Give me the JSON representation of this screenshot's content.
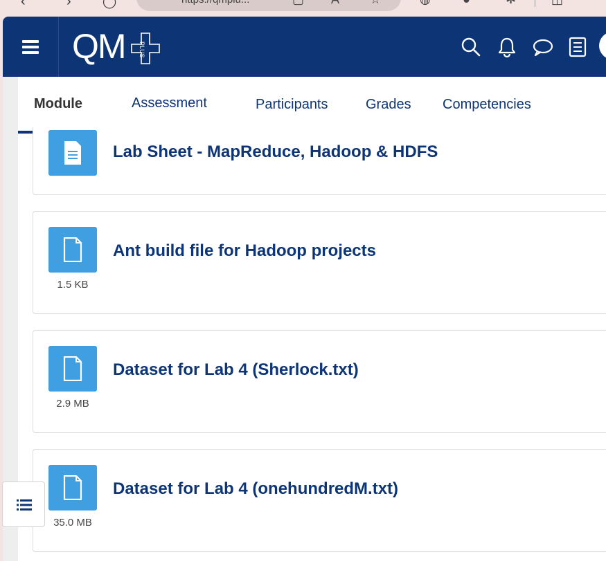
{
  "browser": {
    "url_partial": "https://qmplu..."
  },
  "header": {
    "logo_text": "QM",
    "logo_sub": "PLUS",
    "icons": [
      "search-icon",
      "bell-icon",
      "chat-icon",
      "list-icon"
    ]
  },
  "tabs": [
    {
      "label": "Module",
      "active": true
    },
    {
      "label": "Assessment",
      "active": false
    },
    {
      "label": "Participants",
      "active": false
    },
    {
      "label": "Grades",
      "active": false
    },
    {
      "label": "Competencies",
      "active": false
    }
  ],
  "resources": [
    {
      "title": "Lab Sheet - MapReduce, Hadoop & HDFS",
      "size": "",
      "icon": "document-icon"
    },
    {
      "title": "Ant build file for Hadoop projects",
      "size": "1.5 KB",
      "icon": "file-icon"
    },
    {
      "title": "Dataset for Lab 4 (Sherlock.txt)",
      "size": "2.9 MB",
      "icon": "file-icon"
    },
    {
      "title": "Dataset for Lab 4 (onehundredM.txt)",
      "size": "35.0 MB",
      "icon": "file-icon"
    }
  ],
  "colors": {
    "brand": "#0d3475",
    "file_icon_bg": "#3f9fe0",
    "chrome_bg": "#f3e4e1"
  }
}
